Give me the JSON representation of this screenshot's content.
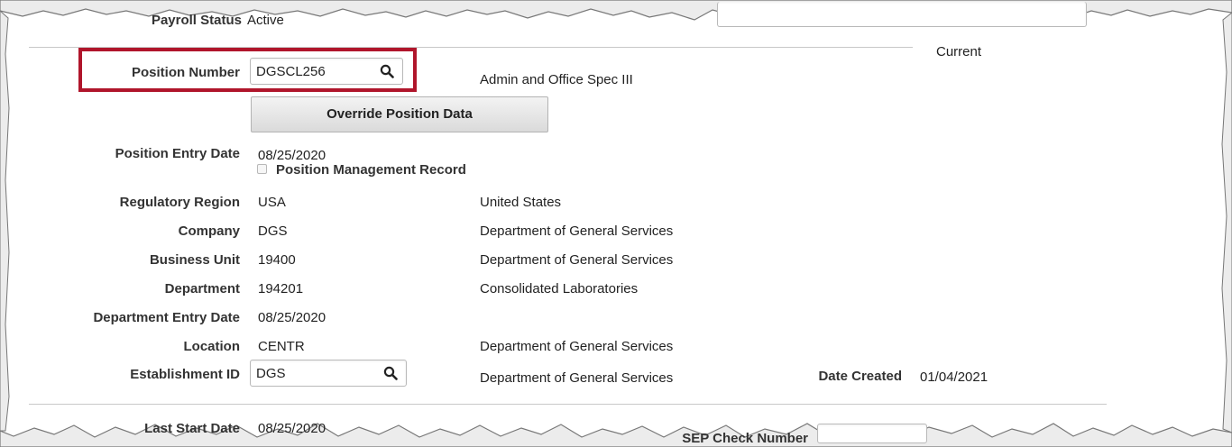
{
  "top": {
    "payroll_status_label": "Payroll Status",
    "payroll_status_value": "Active",
    "effective_sequence_status": "Current"
  },
  "position": {
    "label": "Position Number",
    "value": "DGSCL256",
    "description": "Admin and Office Spec III",
    "override_button": "Override Position Data",
    "entry_date_label": "Position Entry Date",
    "entry_date_value": "08/25/2020",
    "mgmt_record_label": "Position Management Record",
    "mgmt_record_checked": false
  },
  "fields": [
    {
      "label": "Regulatory Region",
      "value": "USA",
      "description": "United States"
    },
    {
      "label": "Company",
      "value": "DGS",
      "description": "Department of General Services"
    },
    {
      "label": "Business Unit",
      "value": "19400",
      "description": "Department of General Services"
    },
    {
      "label": "Department",
      "value": "194201",
      "description": "Consolidated Laboratories"
    },
    {
      "label": "Department Entry Date",
      "value": "08/25/2020",
      "description": ""
    },
    {
      "label": "Location",
      "value": "CENTR",
      "description": "Department of General Services"
    }
  ],
  "establishment": {
    "label": "Establishment ID",
    "value": "DGS",
    "description": "Department of General Services",
    "date_created_label": "Date Created",
    "date_created_value": "01/04/2021"
  },
  "bottom": {
    "last_start_label": "Last Start Date",
    "last_start_value": "08/25/2020",
    "sep_chk_label": "SEP Check Number"
  },
  "colors": {
    "highlight": "#b0152b",
    "border": "#b9b9b9"
  },
  "icons": {
    "prompt_lookup": "magnifier-icon"
  }
}
